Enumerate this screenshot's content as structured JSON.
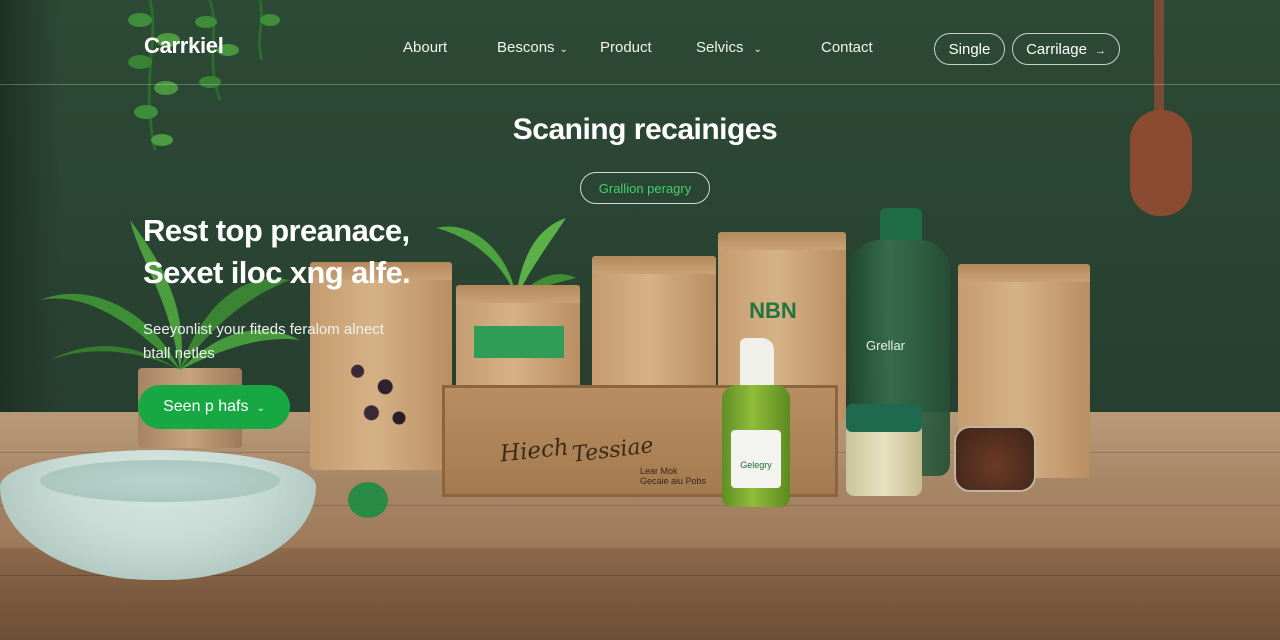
{
  "brand": {
    "logo": "Carrkiel"
  },
  "nav": {
    "items": [
      {
        "label": "Abourt",
        "has_menu": false
      },
      {
        "label": "Bescons",
        "has_menu": true
      },
      {
        "label": "Product",
        "has_menu": false
      },
      {
        "label": "Selvics",
        "has_menu": true
      },
      {
        "label": "Contact",
        "has_menu": false
      }
    ],
    "buttons": [
      {
        "label": "Single"
      },
      {
        "label": "Carrilage",
        "has_arrow": true
      }
    ],
    "chevron_icon": "chevron-down-icon",
    "arrow_icon": "arrow-right-icon"
  },
  "hero": {
    "title": "Scaning recainiges",
    "tag": "Grallion peragry",
    "headline_line1": "Rest top preanace,",
    "headline_line2": "Sexet iloc xng alfe.",
    "subtext_line1": "Seeyonlist your fiteds feralom alnect",
    "subtext_line2": "btall netles",
    "cta_label": "Seen p hafs",
    "accent_color": "#18a843",
    "tag_text_color": "#44d06e"
  },
  "products": {
    "bag_label": "NBN",
    "bottle_label": "Grellar",
    "spray_label": "Gelegry",
    "box_script_1": "Hiech",
    "box_script_2": "Tessiae",
    "box_small_1": "Lear Mok",
    "box_small_2": "Gecaie aiu Pobs"
  }
}
